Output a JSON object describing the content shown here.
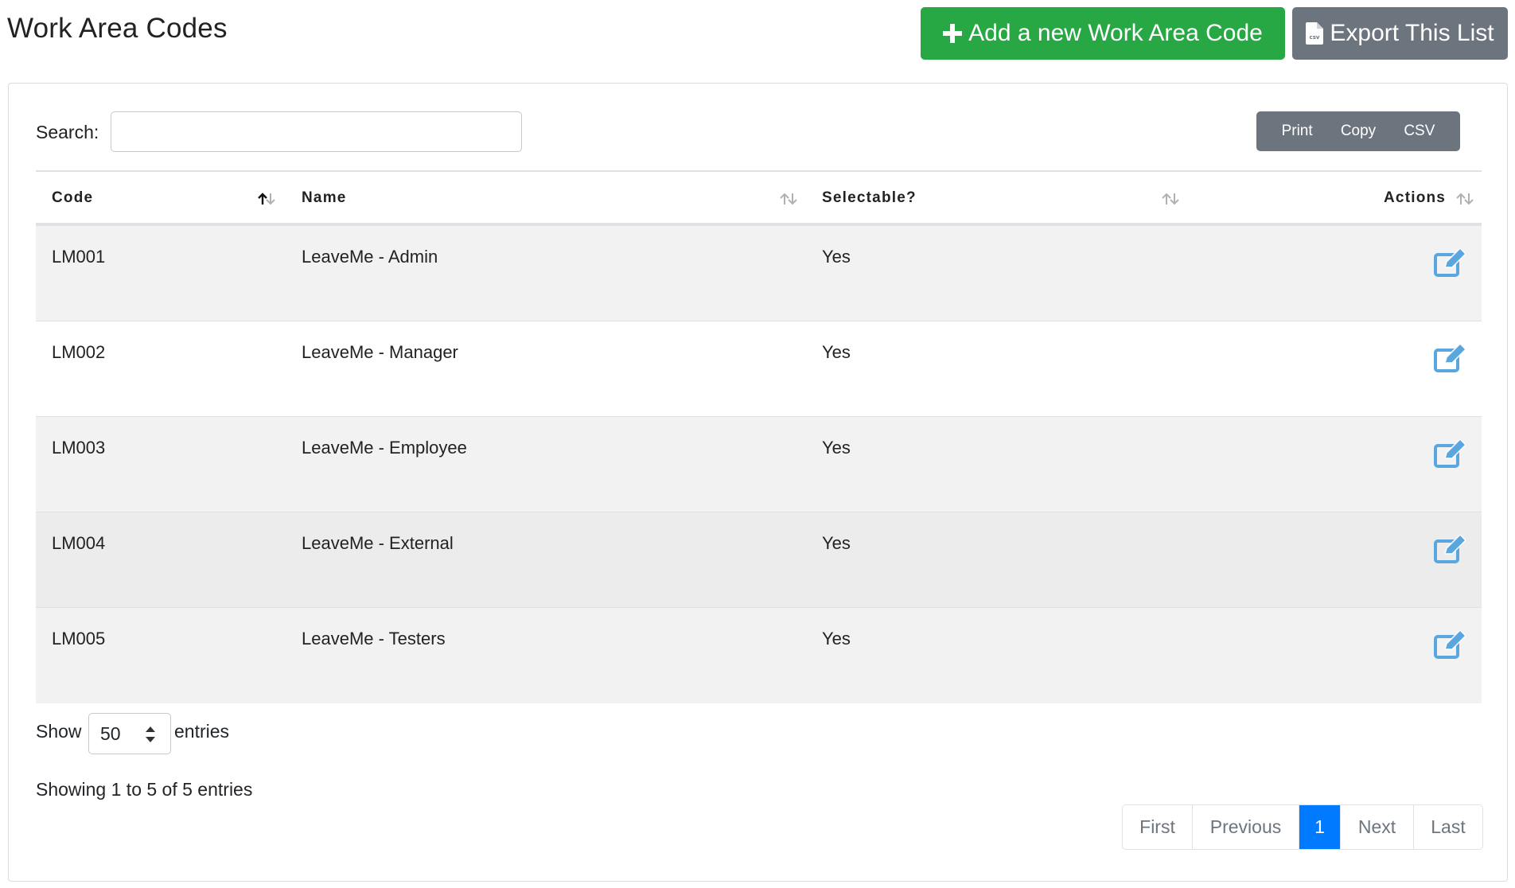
{
  "header": {
    "title": "Work Area Codes",
    "add_button": "Add a new Work Area Code",
    "export_button": "Export This List",
    "add_color": "#28a745",
    "export_color": "#6c757d"
  },
  "search": {
    "label": "Search:",
    "value": "",
    "placeholder": ""
  },
  "export_buttons": [
    "Print",
    "Copy",
    "CSV"
  ],
  "table": {
    "columns": [
      "Code",
      "Name",
      "Selectable?",
      "Actions"
    ],
    "sorted_column": "Code",
    "rows": [
      {
        "code": "LM001",
        "name": "LeaveMe - Admin",
        "selectable": "Yes"
      },
      {
        "code": "LM002",
        "name": "LeaveMe - Manager",
        "selectable": "Yes"
      },
      {
        "code": "LM003",
        "name": "LeaveMe - Employee",
        "selectable": "Yes"
      },
      {
        "code": "LM004",
        "name": "LeaveMe - External",
        "selectable": "Yes"
      },
      {
        "code": "LM005",
        "name": "LeaveMe - Testers",
        "selectable": "Yes"
      }
    ]
  },
  "length": {
    "show_label": "Show",
    "value": "50",
    "entries_label": "entries"
  },
  "info": "Showing 1 to 5 of 5 entries",
  "pagination": {
    "first": "First",
    "previous": "Previous",
    "current": "1",
    "next": "Next",
    "last": "Last",
    "active_color": "#007bff"
  }
}
